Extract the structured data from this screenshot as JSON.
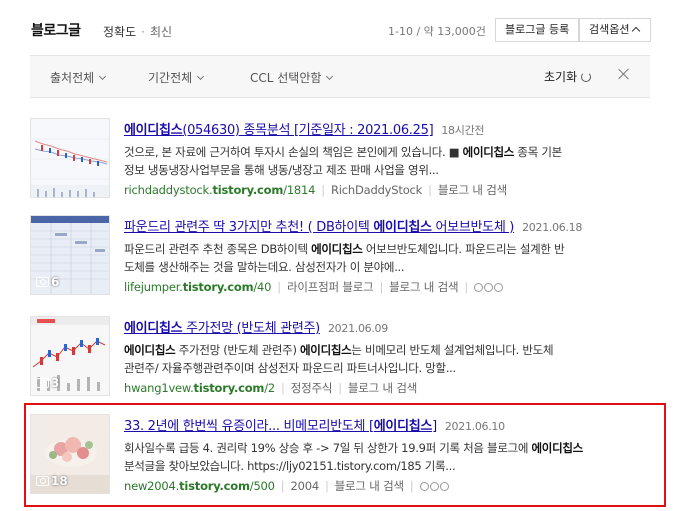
{
  "header": {
    "title": "블로그글",
    "sort_active": "정확도",
    "sort_sep": "·",
    "sort_inactive": "최신",
    "count": "1-10 / 약 13,000건",
    "register_button": "블로그글 등록",
    "options_button": "검색옵션"
  },
  "filters": {
    "source": "출처전체",
    "period": "기간전체",
    "ccl": "CCL 선택안함",
    "reset": "초기화"
  },
  "results": [
    {
      "title_prefix": "",
      "title_bold": "에이디칩스",
      "title_suffix": "(054630) 종목분석 [기준일자 : 2021.06.25]",
      "date": "18시간전",
      "desc_line1_a": "것으로, 본 자료에 근거하여 투자시 손실의 책임은 본인에게 있습니다. ■ ",
      "desc_line1_b": "에이디칩스",
      "desc_line1_c": " 종목 기본",
      "desc_line2": "정보 냉동냉장사업부문을 통해 냉동/냉장고 제조 판매 사업을 영위...",
      "url_prefix": "richdaddystock.",
      "url_bold": "tistory.com",
      "url_suffix": "/1814",
      "blog_name": "RichDaddyStock",
      "inner_search": "블로그 내 검색",
      "photo_count": ""
    },
    {
      "title_prefix": "파운드리 관련주 딱 3가지만 추천! ( DB하이텍 ",
      "title_bold": "에이디칩스",
      "title_suffix": " 어보브반도체 )",
      "date": "2021.06.18",
      "desc_line1_a": "파운드리 관련주 추천 종목은 DB하이텍 ",
      "desc_line1_b": "에이디칩스",
      "desc_line1_c": " 어보브반도체입니다. 파운드리는 설계한 반",
      "desc_line2": "도체를 생산해주는 것을 말하는데요. 삼성전자가 이 분야에...",
      "url_prefix": "lifejumper.",
      "url_bold": "tistory.com",
      "url_suffix": "/40",
      "blog_name": "라이프점퍼 블로그",
      "inner_search": "블로그 내 검색",
      "photo_count": "6"
    },
    {
      "title_prefix": "",
      "title_bold": "에이디칩스",
      "title_suffix": " 주가전망 (반도체 관련주)",
      "date": "2021.06.09",
      "desc_line1_a": "",
      "desc_line1_b": "에이디칩스",
      "desc_line1_c": " 주가전망 (반도체 관련주) ",
      "desc_line1_d": "에이디칩스",
      "desc_line1_e": "는 비메모리 반도체 설계업체입니다. 반도체",
      "desc_line2": "관련주/ 자율주행관련주이며 삼성전자 파운드리 파트너사입니다. 망할...",
      "url_prefix": "hwang1vew.",
      "url_bold": "tistory.com",
      "url_suffix": "/2",
      "blog_name": "정정주식",
      "inner_search": "블로그 내 검색",
      "photo_count": "3"
    },
    {
      "title_prefix": "33. 2년에 한번씩 유증이라... 비메모리반도체 [",
      "title_bold": "에이디칩스",
      "title_suffix": "]",
      "date": "2021.06.10",
      "desc_line1_a": "회사일수록 급등 4. 권리락 19% 상승 후 -> 7일 뒤 상한가 19.9퍼 기록 처음 블로그에 ",
      "desc_line1_b": "에이디칩스",
      "desc_line1_c": "",
      "desc_line2": "분석글을 찾아보았습니다. https://ljy02151.tistory.com/185 기록...",
      "url_prefix": "new2004.",
      "url_bold": "tistory.com",
      "url_suffix": "/500",
      "blog_name": "2004",
      "inner_search": "블로그 내 검색",
      "photo_count": "18"
    }
  ]
}
